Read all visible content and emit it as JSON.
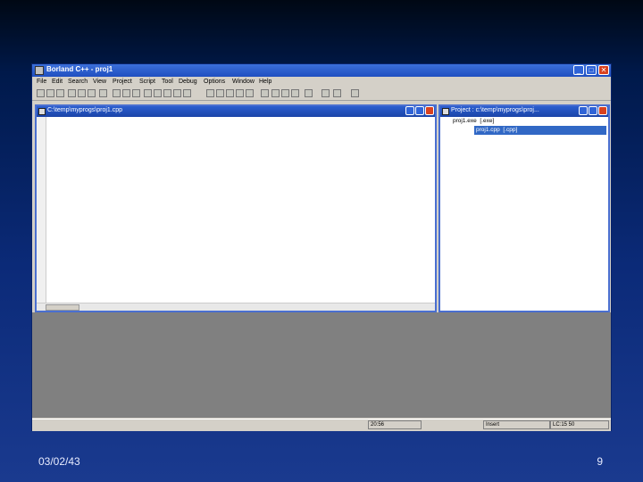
{
  "slide": {
    "date": "03/02/43",
    "page_number": "9"
  },
  "app": {
    "title": "Borland C++ - proj1",
    "window_buttons": {
      "minimize": "_",
      "maximize": "□",
      "close": "✕"
    },
    "menu": [
      "File",
      "Edit",
      "Search",
      "View",
      "Project",
      "Script",
      "Tool",
      "Debug",
      "Options",
      "Window",
      "Help"
    ],
    "toolbar_icons": [
      "new-file-icon",
      "open-icon",
      "save-icon",
      "print-icon",
      "cut-icon",
      "copy-icon",
      "paste-icon",
      "undo-icon",
      "redo-icon",
      "find-icon",
      "replace-icon",
      "compile-icon",
      "make-icon",
      "run-icon",
      "stop-icon",
      "step-icon",
      "trace-icon",
      "breakpoint-icon",
      "watch-icon",
      "inspect-icon",
      "evaluate-icon",
      "help-icon"
    ]
  },
  "editor": {
    "title": "C:\\temp\\myprogs\\proj1.cpp"
  },
  "project": {
    "title": "Project : c:\\temp\\myprogs\\proj...",
    "tree": [
      {
        "text": "proj1.exe  [.exe]",
        "selected": false
      },
      {
        "text": "proj1.cpp  [.cpp]",
        "selected": true
      }
    ]
  },
  "status": {
    "time": "20:56",
    "mode": "Insert",
    "position": "LC:15 50"
  }
}
